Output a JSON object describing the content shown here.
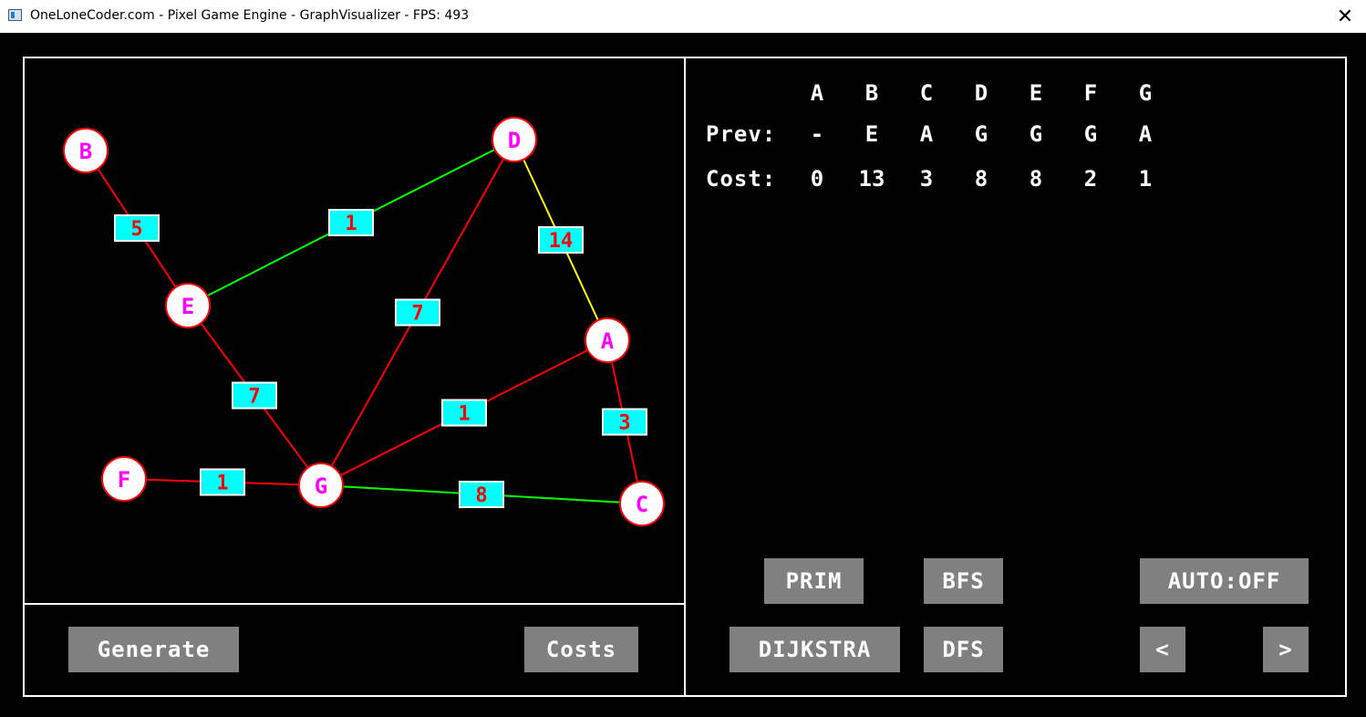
{
  "window": {
    "title": "OneLoneCoder.com - Pixel Game Engine - GraphVisualizer - FPS: 493",
    "close_glyph": "✕"
  },
  "graph": {
    "nodes": [
      {
        "id": "A",
        "label": "A"
      },
      {
        "id": "B",
        "label": "B"
      },
      {
        "id": "C",
        "label": "C"
      },
      {
        "id": "D",
        "label": "D"
      },
      {
        "id": "E",
        "label": "E"
      },
      {
        "id": "F",
        "label": "F"
      },
      {
        "id": "G",
        "label": "G"
      }
    ],
    "edges": [
      {
        "from": "B",
        "to": "E",
        "weight": "5",
        "color": "#ff0000"
      },
      {
        "from": "E",
        "to": "D",
        "weight": "1",
        "color": "#00ff00"
      },
      {
        "from": "D",
        "to": "A",
        "weight": "14",
        "color": "#ffff00"
      },
      {
        "from": "D",
        "to": "G",
        "weight": "7",
        "color": "#ff0000"
      },
      {
        "from": "E",
        "to": "G",
        "weight": "7",
        "color": "#ff0000"
      },
      {
        "from": "G",
        "to": "A",
        "weight": "1",
        "color": "#ff0000"
      },
      {
        "from": "A",
        "to": "C",
        "weight": "3",
        "color": "#ff0000"
      },
      {
        "from": "F",
        "to": "G",
        "weight": "1",
        "color": "#ff0000"
      },
      {
        "from": "G",
        "to": "C",
        "weight": "8",
        "color": "#00ff00"
      }
    ]
  },
  "results": {
    "headers": [
      "A",
      "B",
      "C",
      "D",
      "E",
      "F",
      "G"
    ],
    "prev_label": "Prev:",
    "prev": [
      "-",
      "E",
      "A",
      "G",
      "G",
      "G",
      "A"
    ],
    "cost_label": "Cost:",
    "cost": [
      "0",
      "13",
      "3",
      "8",
      "8",
      "2",
      "1"
    ]
  },
  "buttons": {
    "generate": "Generate",
    "costs": "Costs",
    "prim": "PRIM",
    "bfs": "BFS",
    "auto": "AUTO:OFF",
    "dijkstra": "DIJKSTRA",
    "dfs": "DFS",
    "prev_step": "<",
    "next_step": ">"
  },
  "colors": {
    "node_fill": "#ffffff",
    "node_border": "#ff0000",
    "node_label": "#ff00ff",
    "weight_box": "#00ffff",
    "weight_text": "#ff0000",
    "button_bg": "#808080",
    "frame": "#ffffff"
  }
}
